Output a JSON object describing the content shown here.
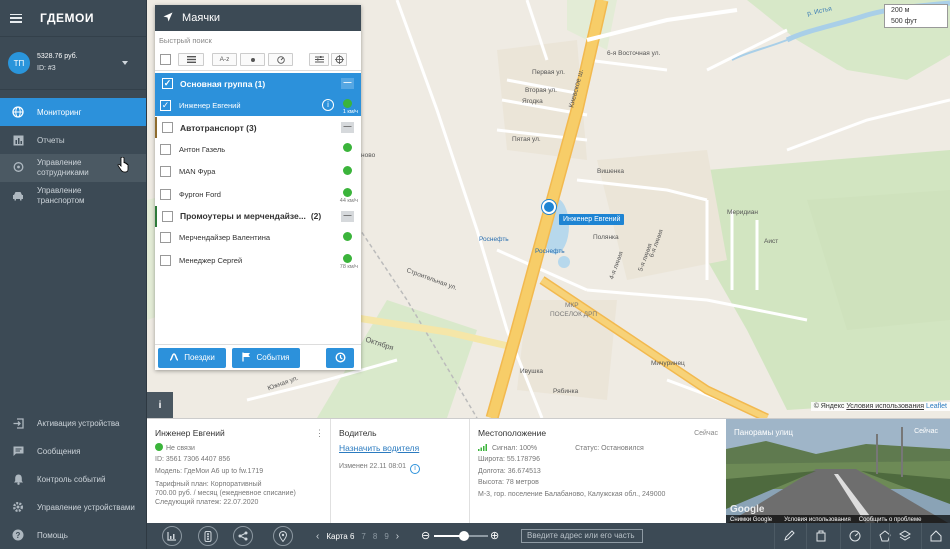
{
  "app": {
    "logo": "ГДЕМОИ",
    "balance": "5328.76 руб.",
    "account_id": "ID: #3",
    "avatar_initials": "ТП"
  },
  "nav": {
    "items": [
      {
        "label": "Мониторинг",
        "icon": "globe-icon",
        "active": true
      },
      {
        "label": "Отчеты",
        "icon": "report-icon"
      },
      {
        "label": "Управление сотрудниками",
        "icon": "location-pin-icon"
      },
      {
        "label": "Управление транспортом",
        "icon": "car-icon"
      }
    ],
    "bottom": [
      {
        "label": "Активация устройства",
        "icon": "login-icon"
      },
      {
        "label": "Сообщения",
        "icon": "message-icon"
      },
      {
        "label": "Контроль событий",
        "icon": "bell-icon"
      },
      {
        "label": "Управление устройствами",
        "icon": "gear-icon"
      },
      {
        "label": "Помощь",
        "icon": "help-icon"
      }
    ]
  },
  "panel": {
    "title": "Маячки",
    "search_placeholder": "Быстрый поиск",
    "sort_label": "A-z",
    "groups": [
      {
        "name": "Основная группа (1)",
        "items": [
          {
            "name": "Инженер Евгений",
            "speed": "1 км/ч",
            "selected": true
          }
        ]
      },
      {
        "name": "Автотранспорт (3)",
        "items": [
          {
            "name": "Антон Газель",
            "speed": ""
          },
          {
            "name": "MAN Фура",
            "speed": ""
          },
          {
            "name": "Фургон Ford",
            "speed": "44 км/ч"
          }
        ]
      },
      {
        "name": "Промоутеры и мерчендайзе...",
        "count": "(2)",
        "items": [
          {
            "name": "Мерчендайзер Валентина",
            "speed": ""
          },
          {
            "name": "Менеджер Сергей",
            "speed": "78 км/ч"
          }
        ]
      }
    ],
    "btn_trips": "Поездки",
    "btn_events": "События"
  },
  "map": {
    "labels": {
      "pervaya": "Первая ул.",
      "vtoraya": "Вторая ул.",
      "yagodka": "Ягодка",
      "pyataya": "Пятая ул.",
      "kievskoe": "Киевское ш.",
      "vostochnaya": "6-я Восточная ул.",
      "vishenka": "Вишенка",
      "meridian": "Меридиан",
      "aist": "Аист",
      "polyanka": "Полянка",
      "line4": "4-я линия",
      "line5": "5-я линия",
      "line6": "6-я линия",
      "rosneft1": "Роснефть",
      "rosneft2": "Роснефть",
      "stroitelnaya": "Строительная ул.",
      "mkr": "МКР",
      "poselok": "ПОСЕЛОК ДРП",
      "oktyabrya": "Октября",
      "yuzhnaya": "Южная ул.",
      "ivushka": "Ивушка",
      "ryabinka": "Рябинка",
      "michurinets": "Мичуринец",
      "river": "р. Истья",
      "novo": "ново"
    },
    "scale_top": "200 м",
    "scale_bottom": "500 фут",
    "copyright": "© Яндекс",
    "terms": "Условия использования",
    "leaflet": "Leaflet",
    "marker_label": "Инженер Евгений"
  },
  "infobar": {
    "person": {
      "name": "Инженер Евгений",
      "status": "Не связи",
      "id_line": "ID: 3561 7306 4407 856",
      "model": "Модель: ГдеМои А6 up to fw.1719",
      "tariff1": "Тарифный план: Корпоративный",
      "tariff2": "700.00 руб. / месяц (ежедневное списание)",
      "next_payment": "Следующий платеж: 22.07.2020"
    },
    "driver": {
      "title": "Водитель",
      "assign_link": "Назначить водителя",
      "changed": "Изменен 22.11 08:01"
    },
    "location": {
      "title": "Местоположение",
      "now": "Сейчас",
      "signal": "Сигнал: 100%",
      "status": "Статус: Остановился",
      "lat": "Широта: 55.178796",
      "lon": "Долгота: 36.674513",
      "alt": "Высота: 78 метров",
      "address": "М-3, гор. поселение Балабаново, Калужская обл., 249000"
    },
    "panorama": {
      "title": "Панорамы улиц",
      "now": "Сейчас",
      "google": "Google",
      "terms": "Условия использования",
      "report": "Сообщить о проблеме",
      "copy": "Снимки Google"
    }
  },
  "bottombar": {
    "map_label": "Карта 6",
    "pages": [
      "7",
      "8",
      "9"
    ],
    "address_placeholder": "Введите адрес или его часть",
    "zoom_level": 0.55
  },
  "colors": {
    "accent": "#2c91db",
    "sidebar": "#3c4a55",
    "status_green": "#3bb43b",
    "road_yellow": "#f6c451"
  }
}
